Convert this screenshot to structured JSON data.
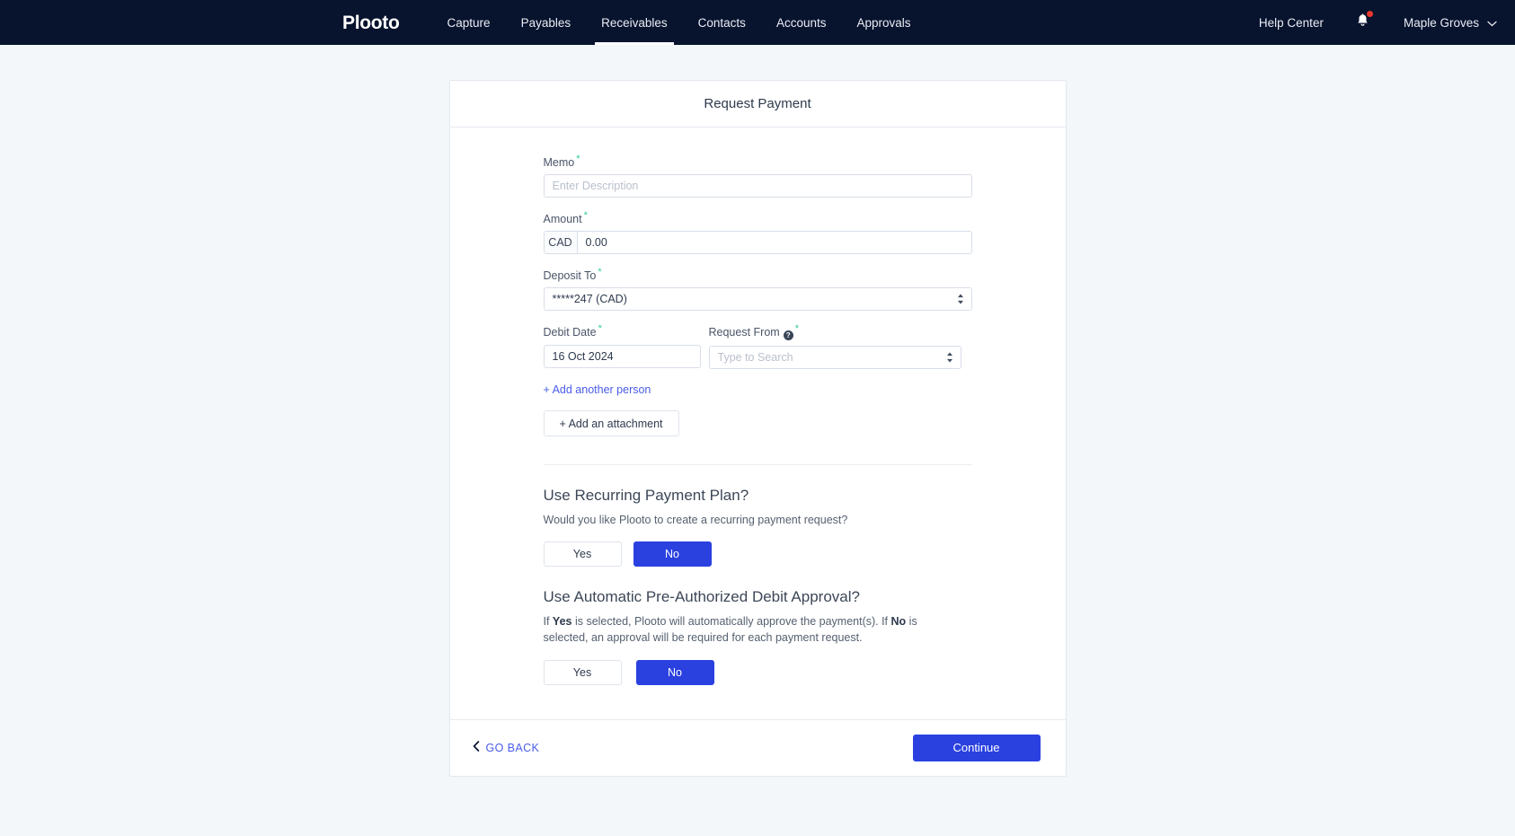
{
  "navbar": {
    "brand": "Plooto",
    "items": [
      {
        "label": "Capture",
        "active": false
      },
      {
        "label": "Payables",
        "active": false
      },
      {
        "label": "Receivables",
        "active": true
      },
      {
        "label": "Contacts",
        "active": false
      },
      {
        "label": "Accounts",
        "active": false
      },
      {
        "label": "Approvals",
        "active": false
      }
    ],
    "help_center": "Help Center",
    "notification_icon": "bell-icon",
    "has_notification_dot": true,
    "account_name": "Maple Groves",
    "account_caret_icon": "chevron-down-icon"
  },
  "card": {
    "title": "Request Payment",
    "required_marker": "*",
    "required_color": "#2ecb99"
  },
  "form": {
    "memo": {
      "label": "Memo",
      "placeholder": "Enter Description",
      "value": ""
    },
    "amount": {
      "label": "Amount",
      "currency": "CAD",
      "value": "0.00"
    },
    "deposit_to": {
      "label": "Deposit To",
      "value": "*****247 (CAD)"
    },
    "debit_date": {
      "label": "Debit Date",
      "value": "16 Oct 2024"
    },
    "request_from": {
      "label": "Request From",
      "help_icon": "question-mark-icon",
      "placeholder": "Type to Search",
      "value": ""
    },
    "add_person_link": "+ Add another person",
    "add_attachment_button": "+ Add an attachment"
  },
  "recurring_section": {
    "title": "Use Recurring Payment Plan?",
    "description": "Would you like Plooto to create a recurring payment request?",
    "yes_label": "Yes",
    "no_label": "No",
    "selected": "No"
  },
  "pad_section": {
    "title": "Use Automatic Pre-Authorized Debit Approval?",
    "desc_part1": "If ",
    "desc_bold1": "Yes",
    "desc_part2": " is selected, Plooto will automatically approve the payment(s). If ",
    "desc_bold2": "No",
    "desc_part3": " is selected, an approval will be required for each payment request.",
    "yes_label": "Yes",
    "no_label": "No",
    "selected": "No"
  },
  "footer": {
    "go_back": "GO BACK",
    "go_back_icon": "chevron-left-icon",
    "continue": "Continue"
  },
  "colors": {
    "nav_bg": "#08132e",
    "primary": "#2a41e0",
    "link": "#4a5ce8",
    "accent_required": "#2ecb99",
    "notification_dot": "#e8382c",
    "page_bg": "#f4f7fa"
  }
}
